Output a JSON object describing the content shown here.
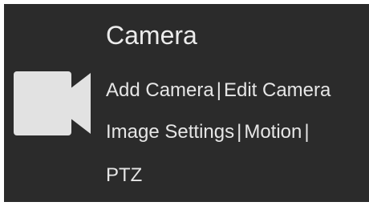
{
  "section": {
    "title": "Camera",
    "icon": "video-camera-icon",
    "links": {
      "add_camera": "Add Camera",
      "edit_camera": "Edit Camera",
      "image_settings": "Image Settings",
      "motion": "Motion",
      "ptz": "PTZ"
    },
    "separator": "|"
  },
  "colors": {
    "panel_background": "#2b2b2b",
    "text": "#e9e9e9",
    "icon": "#e2e2e2"
  }
}
